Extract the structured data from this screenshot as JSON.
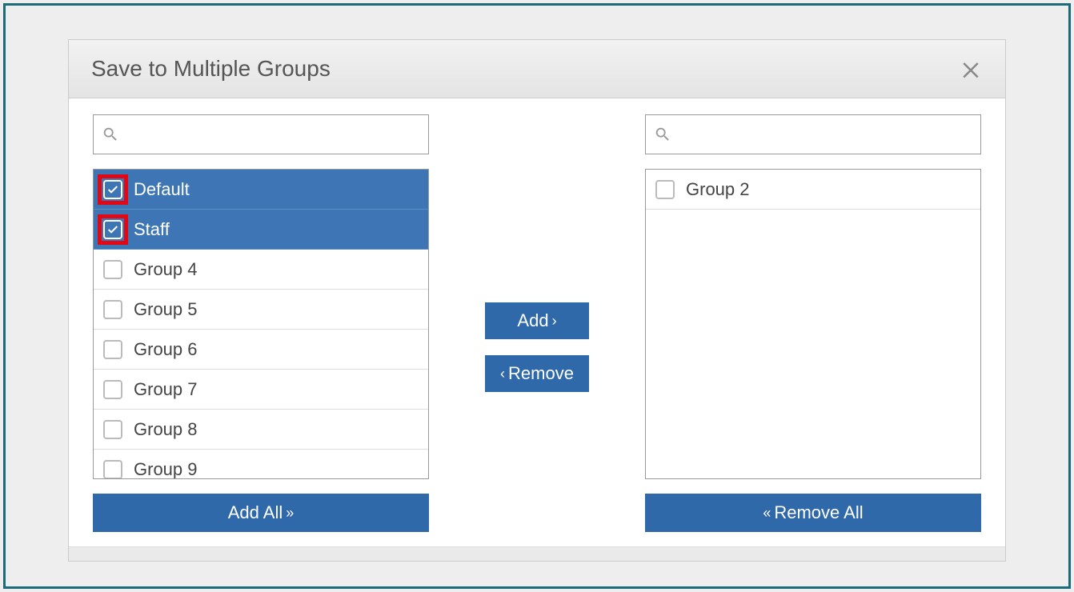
{
  "dialog": {
    "title": "Save to Multiple Groups"
  },
  "left": {
    "search_placeholder": "",
    "items": [
      {
        "label": "Default",
        "checked": true,
        "highlighted": true
      },
      {
        "label": "Staff",
        "checked": true,
        "highlighted": true
      },
      {
        "label": "Group 4",
        "checked": false,
        "highlighted": false
      },
      {
        "label": "Group 5",
        "checked": false,
        "highlighted": false
      },
      {
        "label": "Group 6",
        "checked": false,
        "highlighted": false
      },
      {
        "label": "Group 7",
        "checked": false,
        "highlighted": false
      },
      {
        "label": "Group 8",
        "checked": false,
        "highlighted": false
      },
      {
        "label": "Group 9",
        "checked": false,
        "highlighted": false
      }
    ],
    "footer_button": "Add All"
  },
  "right": {
    "search_placeholder": "",
    "items": [
      {
        "label": "Group 2",
        "checked": false
      }
    ],
    "footer_button": "Remove All"
  },
  "middle": {
    "add_label": "Add",
    "remove_label": "Remove"
  }
}
